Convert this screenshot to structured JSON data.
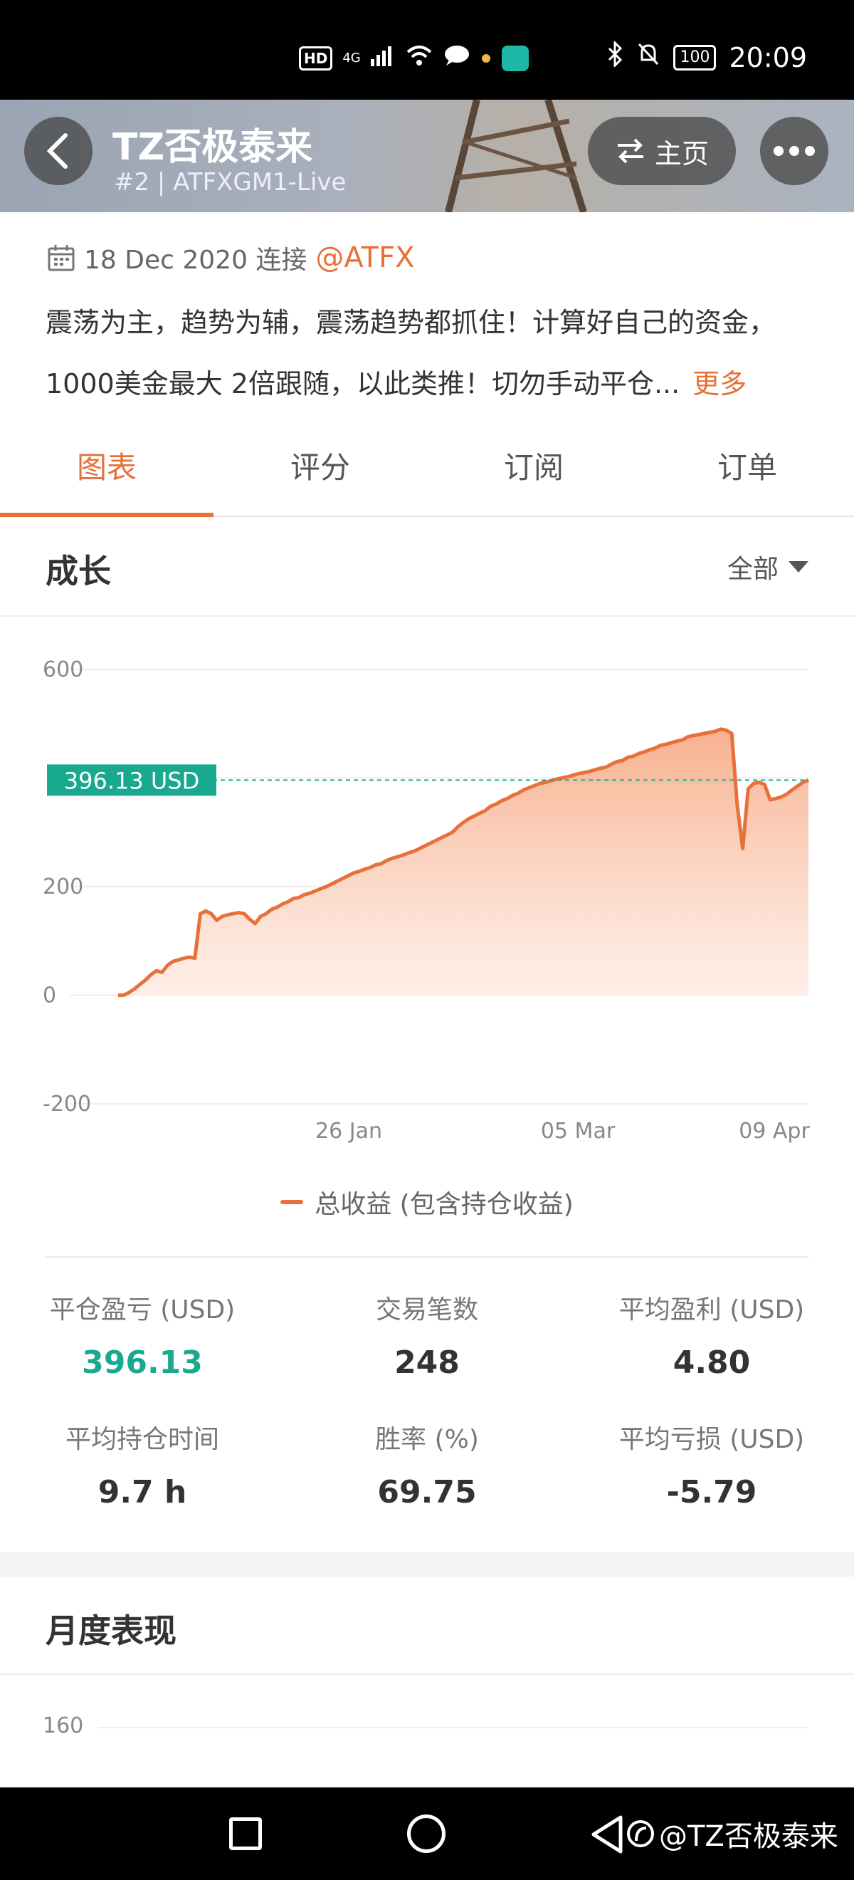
{
  "status_bar": {
    "left_icons": [
      "HD",
      "4G",
      "signal",
      "wifi",
      "chat",
      "dot",
      "app"
    ],
    "battery": "100",
    "time": "20:09"
  },
  "header": {
    "title": "TZ否极泰来",
    "subtitle": "#2 | ATFXGM1-Live",
    "home_label": "主页"
  },
  "info": {
    "date": "18 Dec 2020 连接",
    "mention": "@ATFX",
    "desc_line1": "震荡为主，趋势为辅，震荡趋势都抓住！计算好自己的资金，",
    "desc_line2": "1000美金最大 2倍跟随，以此类推！切勿手动平仓...",
    "more": "更多"
  },
  "tabs": [
    {
      "label": "图表",
      "active": true
    },
    {
      "label": "评分",
      "active": false
    },
    {
      "label": "订阅",
      "active": false
    },
    {
      "label": "订单",
      "active": false
    }
  ],
  "growth": {
    "title": "成长",
    "filter": "全部"
  },
  "chart_data": {
    "type": "area",
    "ylim": [
      -200,
      600
    ],
    "y_ticks": [
      "600",
      "",
      "200",
      "0",
      "-200"
    ],
    "x_ticks": [
      "26 Jan",
      "05 Mar",
      "09 Apr"
    ],
    "current_label": "396.13 USD",
    "current_value": 396.13,
    "line_color": "#e8703a",
    "reference_color": "#19a98f",
    "series": [
      {
        "name": "总收益 (包含持仓收益)",
        "values": [
          0,
          0,
          5,
          12,
          20,
          28,
          38,
          45,
          42,
          55,
          62,
          65,
          68,
          70,
          68,
          150,
          155,
          150,
          138,
          145,
          148,
          150,
          152,
          150,
          140,
          132,
          145,
          150,
          158,
          162,
          168,
          172,
          178,
          180,
          185,
          188,
          192,
          196,
          200,
          205,
          210,
          215,
          220,
          225,
          228,
          232,
          235,
          240,
          242,
          248,
          252,
          255,
          258,
          262,
          265,
          270,
          275,
          280,
          285,
          290,
          295,
          300,
          310,
          318,
          325,
          330,
          335,
          340,
          348,
          352,
          358,
          362,
          368,
          372,
          378,
          382,
          386,
          390,
          392,
          395,
          398,
          400,
          402,
          405,
          408,
          410,
          412,
          415,
          418,
          420,
          425,
          430,
          432,
          438,
          440,
          445,
          448,
          452,
          455,
          460,
          462,
          465,
          468,
          470,
          476,
          478,
          480,
          482,
          484,
          486,
          490,
          488,
          482,
          350,
          270,
          380,
          390,
          392,
          388,
          360,
          362,
          365,
          370,
          378,
          385,
          392,
          396.13
        ]
      }
    ]
  },
  "legend_label": "总收益 (包含持仓收益)",
  "stats": {
    "realized_label": "平仓盈亏 (USD)",
    "realized_value": "396.13",
    "trades_label": "交易笔数",
    "trades_value": "248",
    "avg_profit_label": "平均盈利 (USD)",
    "avg_profit_value": "4.80",
    "avg_hold_label": "平均持仓时间",
    "avg_hold_value": "9.7 h",
    "win_rate_label": "胜率 (%)",
    "win_rate_value": "69.75",
    "avg_loss_label": "平均亏损 (USD)",
    "avg_loss_value": "-5.79"
  },
  "monthly": {
    "title": "月度表现",
    "first_tick": "160"
  },
  "nav_bar": {
    "watermark": "@TZ否极泰来"
  }
}
